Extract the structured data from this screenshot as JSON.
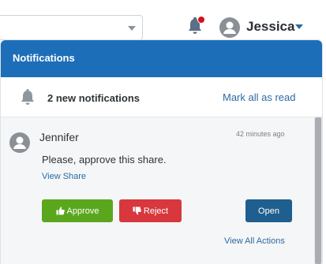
{
  "topbar": {
    "user": {
      "name": "Jessica"
    },
    "notification_badge_color": "#d3101c"
  },
  "panel": {
    "title": "Notifications",
    "header_color": "#1d6eb8",
    "summary": {
      "count_text": "2 new notifications",
      "mark_all_label": "Mark all as read"
    },
    "items": [
      {
        "sender": "Jennifer",
        "time": "42 minutes ago",
        "message": "Please, approve this share.",
        "view_link": "View Share",
        "approve_label": "Approve",
        "reject_label": "Reject",
        "open_label": "Open"
      }
    ],
    "view_all_label": "View All Actions"
  },
  "colors": {
    "approve": "#5aa71e",
    "reject": "#d7373d",
    "open": "#1e5f8f",
    "link": "#2c6aa3"
  },
  "icons": [
    "chevron-down-icon",
    "bell-icon",
    "user-avatar-icon",
    "thumbs-up-icon",
    "thumbs-down-icon"
  ]
}
